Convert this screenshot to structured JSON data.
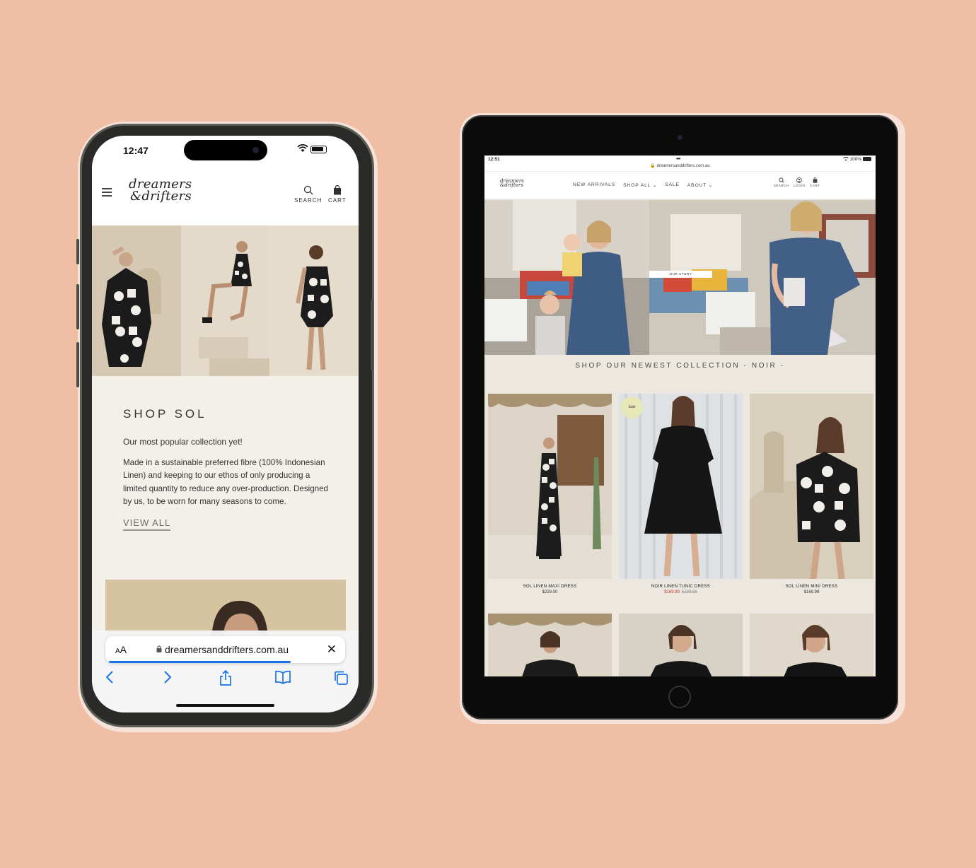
{
  "phone": {
    "status": {
      "time": "12:47"
    },
    "header": {
      "logo_line1": "dreamers",
      "logo_line2": "&drifters",
      "search_label": "SEARCH",
      "cart_label": "CART"
    },
    "section": {
      "title": "SHOP SOL",
      "subtitle": "Our most popular collection yet!",
      "body": "Made in a sustainable preferred fibre (100% Indonesian Linen) and keeping to our ethos of only producing a limited quantity to reduce any over-production. Designed by us, to be worn for many seasons to come.",
      "cta": "VIEW ALL"
    },
    "safari": {
      "aa_small": "A",
      "aa_big": "A",
      "url": "dreamersanddrifters.com.au",
      "progress": 0.78
    }
  },
  "tablet": {
    "status": {
      "time": "12:51",
      "battery": "100%",
      "url": "dreamersanddrifters.com.au"
    },
    "nav": {
      "logo_line1": "dreamers",
      "logo_line2": "&drifters",
      "items": [
        "NEW ARRIVALS",
        "SHOP ALL",
        "SALE",
        "ABOUT"
      ],
      "search_label": "SEARCH",
      "login_label": "LOGIN",
      "cart_label": "CART"
    },
    "hero": {
      "story_button": "OUR STORY"
    },
    "collection_title": "SHOP OUR NEWEST COLLECTION - NOIR -",
    "products": [
      {
        "name": "SOL LINEN MAXI DRESS",
        "price": "$229.00"
      },
      {
        "name": "NOIR LINEN TUNIC DRESS",
        "sale_price": "$169.99",
        "old_price": "$199.99",
        "badge": "Sale"
      },
      {
        "name": "SOL LINEN MINI DRESS",
        "price": "$169.99"
      }
    ]
  },
  "colors": {
    "background": "#f0bea5",
    "accent_blue": "#1a73e8",
    "sale_red": "#c0392b",
    "content_bg": "#f3efe9"
  }
}
